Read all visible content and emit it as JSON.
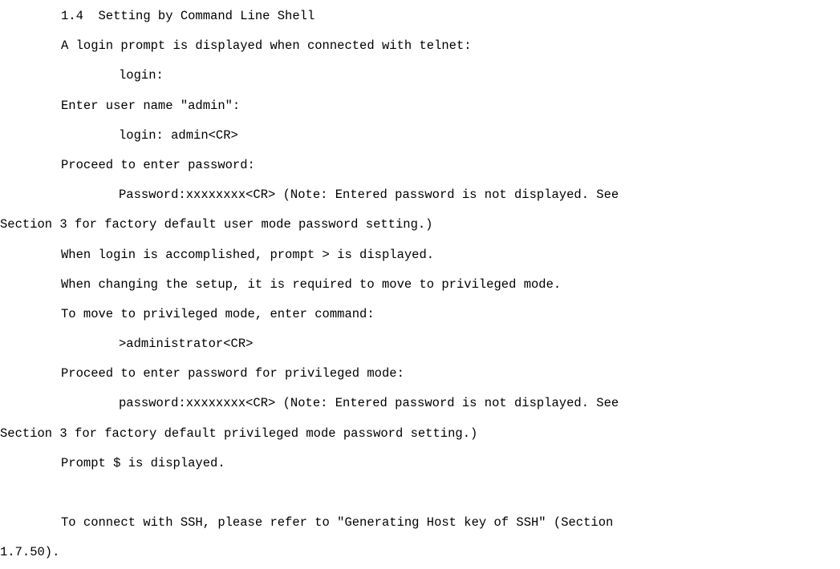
{
  "doc": {
    "heading": "1.4  Setting by Command Line Shell",
    "p1": "A login prompt is displayed when connected with telnet:",
    "c1": "login:",
    "p2": "Enter user name \"admin\":",
    "c2": "login: admin<CR>",
    "p3": "Proceed to enter password:",
    "c3a": "Password:xxxxxxxx<CR> (Note: Entered password is not displayed. See",
    "c3b": "Section 3 for factory default user mode password setting.)",
    "p4": "When login is accomplished, prompt > is displayed.",
    "p5": "When changing the setup, it is required to move to privileged mode.",
    "p6": "To move to privileged mode, enter command:",
    "c4": ">administrator<CR>",
    "p7": "Proceed to enter password for privileged mode:",
    "c5a": "password:xxxxxxxx<CR> (Note: Entered password is not displayed. See",
    "c5b": "Section 3 for factory default privileged mode password setting.)",
    "p8": "Prompt $ is displayed.",
    "p9a": "To connect with SSH, please refer to \"Generating Host key of SSH\" (Section",
    "p9b": "1.7.50)."
  }
}
